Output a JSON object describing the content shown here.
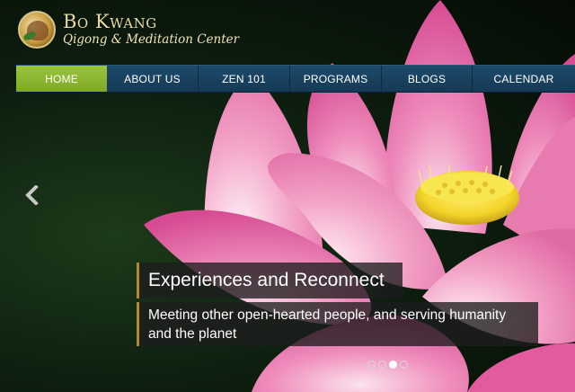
{
  "logo": {
    "name": "Bo Kwang",
    "tagline": "Qigong & Meditation Center"
  },
  "nav": {
    "items": [
      {
        "label": "HOME",
        "active": true
      },
      {
        "label": "ABOUT US",
        "active": false
      },
      {
        "label": "ZEN 101",
        "active": false
      },
      {
        "label": "PROGRAMS",
        "active": false
      },
      {
        "label": "BLOGS",
        "active": false
      },
      {
        "label": "CALENDAR",
        "active": false
      }
    ]
  },
  "slider": {
    "title": "Experiences and Reconnect",
    "text": "Meeting other open-hearted people, and serving humanity and the planet",
    "prev_icon": "chevron-left-icon",
    "slide_count": 4,
    "active_slide": 3
  },
  "colors": {
    "nav_bg": "#1d4a6b",
    "nav_active": "#8cb831",
    "petal": "#e86aa8",
    "caption_accent": "#b38a2a"
  }
}
